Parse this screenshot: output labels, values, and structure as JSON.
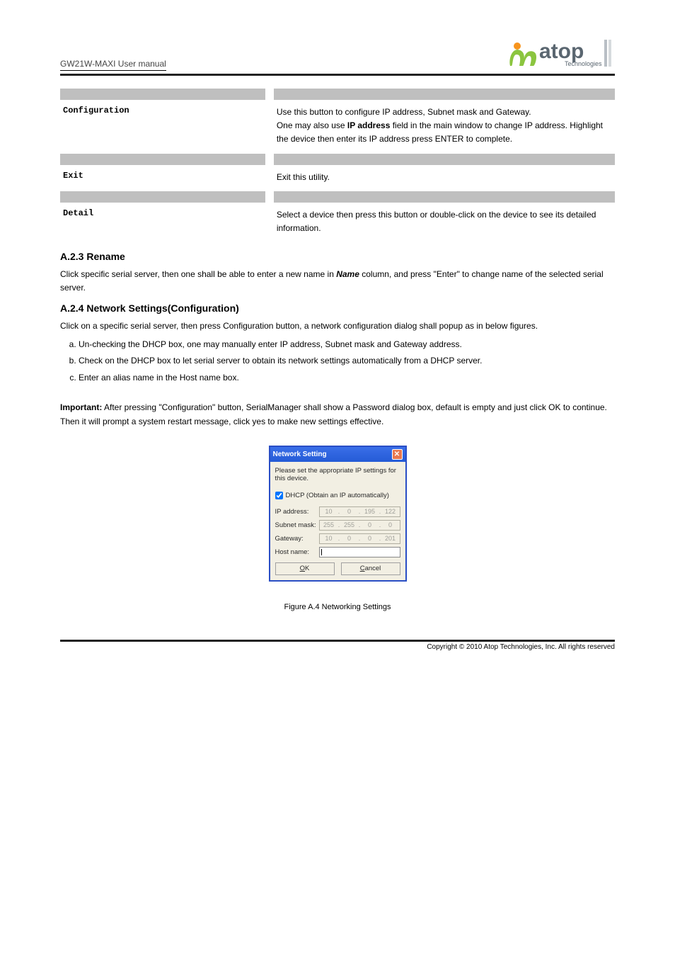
{
  "header": {
    "doc_title": "GW21W-MAXI User manual",
    "logo_main": "atop",
    "logo_sub": "Technologies"
  },
  "rows": [
    {
      "label": "Configuration",
      "desc1": "Use this button to configure IP address, Subnet mask and Gateway.",
      "desc2": "One may also use ",
      "desc2_bold": "IP address",
      "desc2_after": " field in the main window to change IP address. Highlight the device then enter its IP address press ENTER to complete."
    },
    {
      "label": "Exit",
      "desc1": "Exit this utility."
    },
    {
      "label": "Detail",
      "desc1": "Select a device then press this button or double-click on the device to see its detailed information."
    }
  ],
  "section_rename": {
    "heading": "A.2.3 Rename",
    "para_before": "Click specific serial server, then one shall be able to enter a new name in ",
    "para_italic": "Name",
    "para_after": " column, and press \"Enter\" to change name of the selected serial server."
  },
  "section_net": {
    "heading": "A.2.4 Network Settings(Configuration)",
    "para": "Click on a specific serial server, then press Configuration button, a network configuration dialog shall popup as in below figures.",
    "list": [
      "Un-checking the DHCP box, one may manually enter IP address, Subnet mask and Gateway address.",
      "Check on the DHCP box to let serial server to obtain its network settings automatically from a DHCP server.",
      "Enter an alias name in the Host name box."
    ],
    "important_lead": "Important:",
    "important_text": " After pressing \"Configuration\" button, SerialManager shall show a Password dialog box, default is empty and just click OK to continue. Then it will prompt a system restart message, click yes to make new settings effective."
  },
  "dialog": {
    "title": "Network Setting",
    "msg": "Please set the appropriate IP settings for this device.",
    "dhcp_label": "DHCP (Obtain an IP automatically)",
    "fields": {
      "ip_label": "IP address:",
      "ip_value": [
        "10",
        "0",
        "195",
        "122"
      ],
      "subnet_label": "Subnet mask:",
      "subnet_value": [
        "255",
        "255",
        "0",
        "0"
      ],
      "gateway_label": "Gateway:",
      "gateway_value": [
        "10",
        "0",
        "0",
        "201"
      ],
      "hostname_label": "Host name:"
    },
    "ok_pre": "",
    "ok_u": "O",
    "ok_post": "K",
    "cancel_pre": "",
    "cancel_u": "C",
    "cancel_post": "ancel"
  },
  "figure_caption": "Figure A.4 Networking Settings",
  "footer": "Copyright © 2010 Atop Technologies, Inc. All rights reserved"
}
